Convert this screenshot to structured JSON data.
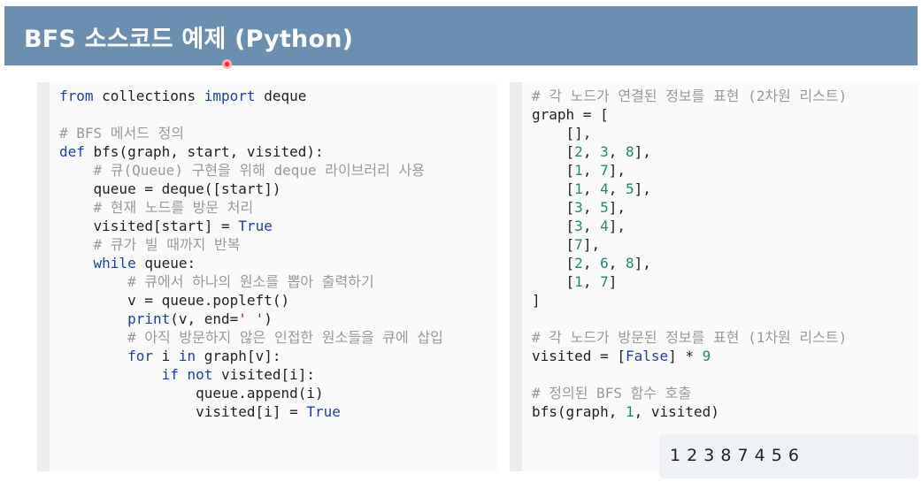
{
  "header": {
    "title": "BFS 소스코드 예제 (Python)",
    "bg_color": "#6b8fb0"
  },
  "left_code": {
    "import_kw1": "from",
    "import_mid": " collections ",
    "import_kw2": "import",
    "import_end": " deque",
    "c1": "# BFS 메서드 정의",
    "def_kw": "def",
    "def_sig": " bfs(graph, start, visited):",
    "c2": "# 큐(Queue) 구현을 위해 deque 라이브러리 사용",
    "queue_init": "queue = deque([start])",
    "c3": "# 현재 노드를 방문 처리",
    "visited_start": "visited[start] = ",
    "true1": "True",
    "c4": "# 큐가 빌 때까지 반복",
    "while_kw": "while",
    "while_rest": " queue:",
    "c5": "# 큐에서 하나의 원소를 뽑아 출력하기",
    "popleft": "v = queue.popleft()",
    "print_kw": "print",
    "print_args": "(v, end=",
    "print_str": "' '",
    "print_close": ")",
    "c6": "# 아직 방문하지 않은 인접한 원소들을 큐에 삽입",
    "for_kw": "for",
    "for_var": " i ",
    "in_kw": "in",
    "for_rest": " graph[v]:",
    "if_kw": "if",
    "not_kw": "not",
    "if_rest": " visited[i]:",
    "append": "queue.append(i)",
    "visited_i": "visited[i] = ",
    "true2": "True"
  },
  "right_code": {
    "c1": "# 각 노드가 연결된 정보를 표현 (2차원 리스트)",
    "graph_open": "graph = [",
    "rows": [
      "[],",
      "[2, 3, 8],",
      "[1, 7],",
      "[1, 4, 5],",
      "[3, 5],",
      "[3, 4],",
      "[7],",
      "[2, 6, 8],",
      "[1, 7]"
    ],
    "graph_close": "]",
    "c2": "# 각 노드가 방문된 정보를 표현 (1차원 리스트)",
    "visited_lhs": "visited = [",
    "false_kw": "False",
    "visited_mid": "] * ",
    "visited_num": "9",
    "c3": "# 정의된 BFS 함수 호출",
    "call_start": "bfs(graph, ",
    "call_num": "1",
    "call_end": ", visited)"
  },
  "output": {
    "text": "1 2 3 8 7 4 5 6"
  },
  "colors": {
    "keyword": "#1a3fb0",
    "comment": "#9a9a9a",
    "number": "#1f8a6e",
    "string": "#b02020"
  }
}
